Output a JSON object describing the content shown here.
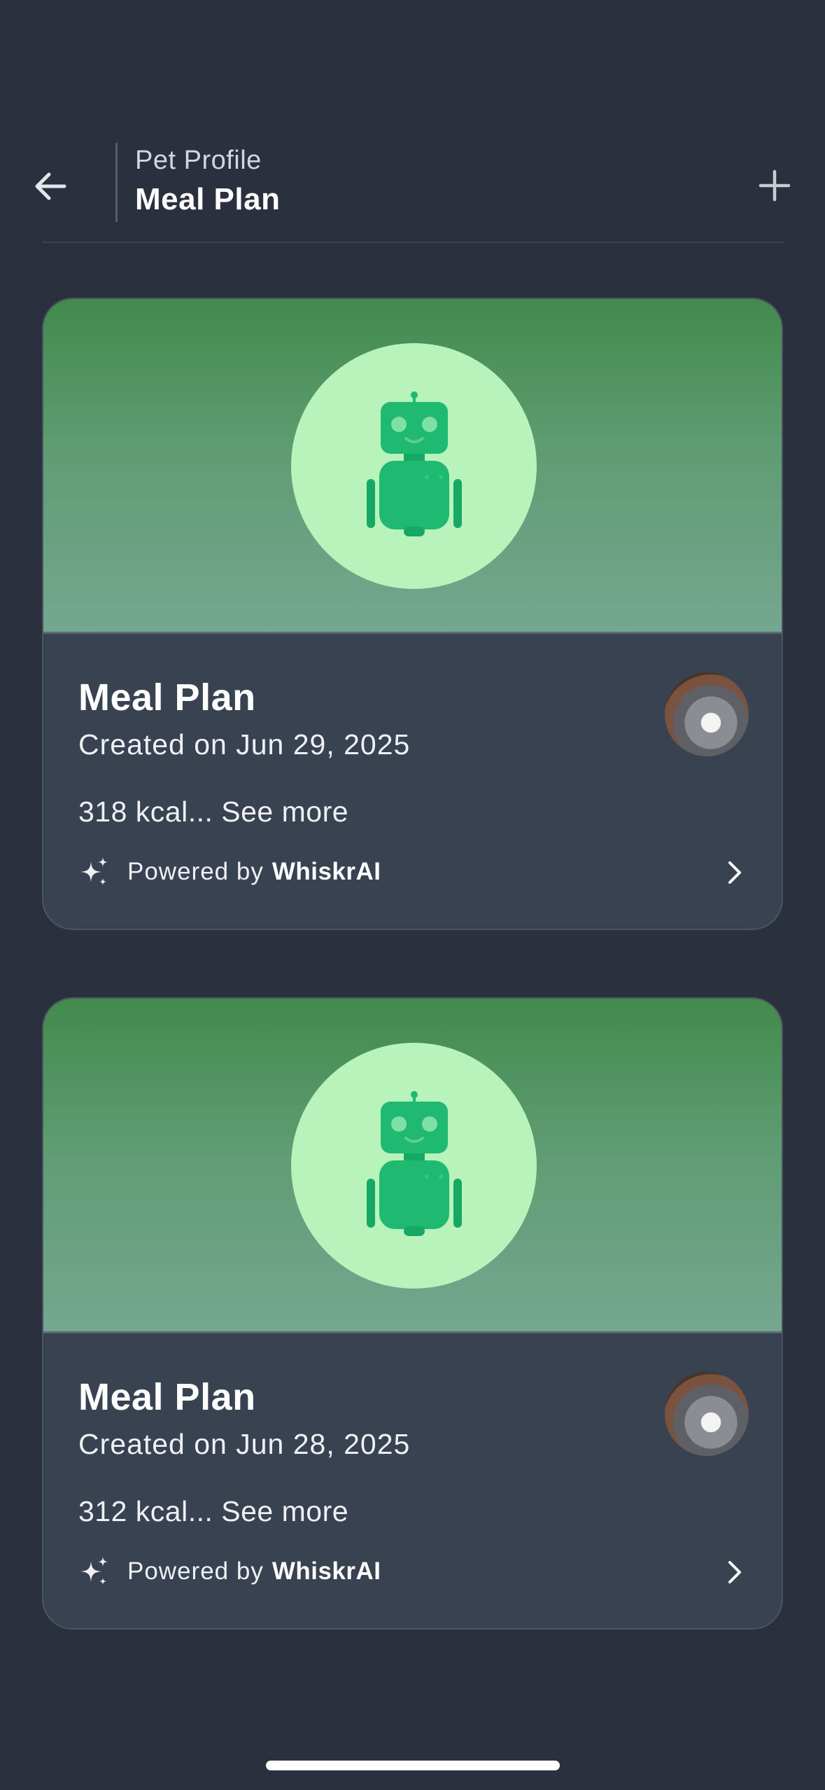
{
  "header": {
    "subtitle": "Pet Profile",
    "title": "Meal Plan",
    "back_icon": "arrow-left-icon",
    "add_icon": "plus-icon"
  },
  "cards": [
    {
      "title": "Meal Plan",
      "date": "Created on Jun 29, 2025",
      "summary": "318 kcal... See more",
      "powered_prefix": "Powered by",
      "powered_brand": "WhiskrAI",
      "hero_icon": "robot-icon",
      "avatar": "cat-avatar"
    },
    {
      "title": "Meal Plan",
      "date": "Created on Jun 28, 2025",
      "summary": "312 kcal... See more",
      "powered_prefix": "Powered by",
      "powered_brand": "WhiskrAI",
      "hero_icon": "robot-icon",
      "avatar": "cat-avatar"
    }
  ],
  "colors": {
    "background": "#2a303d",
    "card": "#394250",
    "hero_top": "#428a4d",
    "hero_bottom": "#74a790",
    "hero_circle": "#b8f3bc",
    "robot": "#1fb971"
  }
}
